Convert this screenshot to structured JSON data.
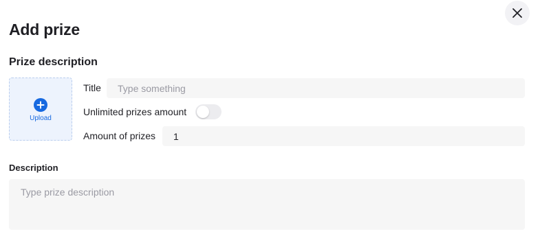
{
  "dialog": {
    "title": "Add prize",
    "close_icon": "close-icon"
  },
  "prize_description": {
    "heading": "Prize description",
    "upload": {
      "label": "Upload",
      "icon": "plus-circle-icon",
      "accent_color": "#1769e0"
    },
    "title_field": {
      "label": "Title",
      "value": "",
      "placeholder": "Type something"
    },
    "unlimited_toggle": {
      "label": "Unlimited prizes amount",
      "on": false
    },
    "amount_field": {
      "label": "Amount of prizes",
      "value": "1"
    }
  },
  "description": {
    "heading": "Description",
    "value": "",
    "placeholder": "Type prize description"
  }
}
